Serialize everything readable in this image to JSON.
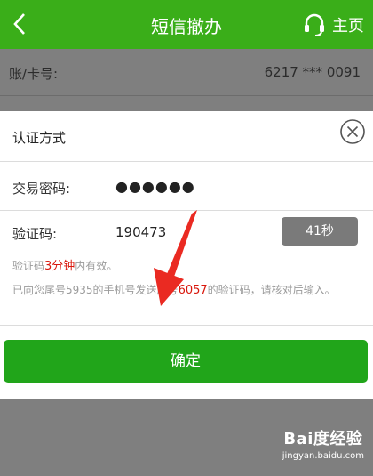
{
  "header": {
    "title": "短信撤办",
    "home_label": "主页"
  },
  "account_row": {
    "label": "账/卡号:",
    "value": "6217 *** 0091"
  },
  "dialog": {
    "title": "认证方式",
    "password": {
      "label": "交易密码:",
      "value": "●●●●●●"
    },
    "code": {
      "label": "验证码:",
      "value": "190473",
      "countdown": "41秒"
    },
    "validity": {
      "prefix": "验证码",
      "duration": "3分钟",
      "suffix": "内有效。"
    },
    "sent_notice": {
      "prefix": "已向您尾号5935的手机号发",
      "middle_obscured": "送序号",
      "serial": "6057",
      "suffix": "的验证码，请核对后输入。"
    },
    "confirm_label": "确定"
  },
  "watermark": {
    "brand": "Bai度经验",
    "url": "jingyan.baidu.com"
  },
  "colors": {
    "header": "#3aae19",
    "confirm": "#21a51a",
    "highlight": "#d9170c",
    "arrow": "#ea2a22"
  }
}
